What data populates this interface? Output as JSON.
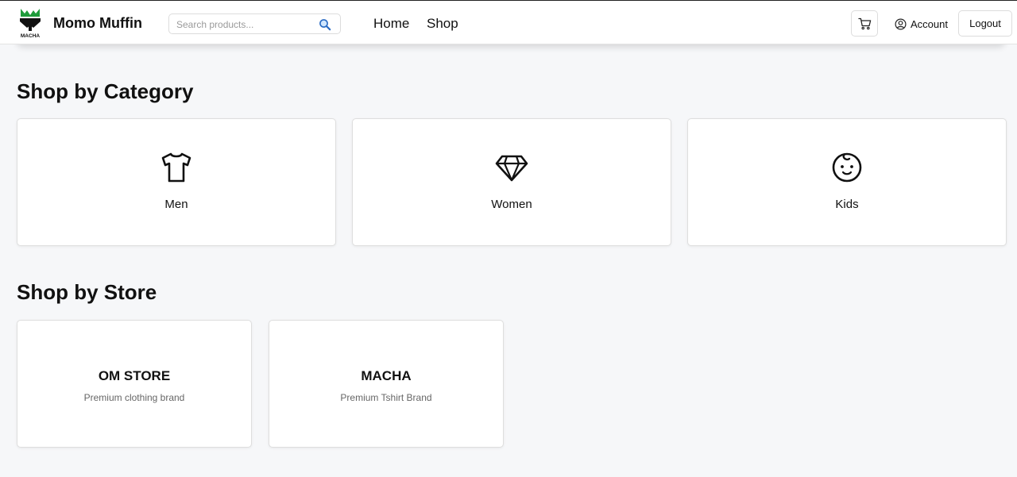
{
  "header": {
    "brand_name": "Momo Muffin",
    "logo_text": "MACHA",
    "search_placeholder": "Search products...",
    "search_icon": "magnifier-icon",
    "nav": [
      {
        "label": "Home"
      },
      {
        "label": "Shop"
      }
    ],
    "cart_icon": "cart-icon",
    "account_icon": "user-circle-icon",
    "account_label": "Account",
    "logout_label": "Logout"
  },
  "categories": {
    "title": "Shop by Category",
    "items": [
      {
        "label": "Men",
        "icon": "tshirt-icon"
      },
      {
        "label": "Women",
        "icon": "diamond-icon"
      },
      {
        "label": "Kids",
        "icon": "baby-face-icon"
      }
    ]
  },
  "stores": {
    "title": "Shop by Store",
    "items": [
      {
        "name": "OM STORE",
        "description": "Premium clothing brand"
      },
      {
        "name": "MACHA",
        "description": "Premium Tshirt Brand"
      }
    ]
  },
  "colors": {
    "page_background": "#f6f7f9",
    "logo_green": "#1e9b3a",
    "text": "#111111",
    "muted_text": "#666666"
  }
}
